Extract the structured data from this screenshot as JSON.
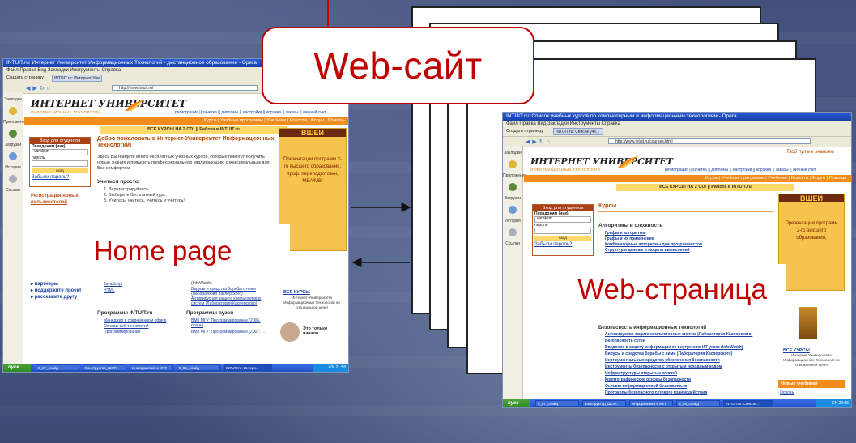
{
  "callout": {
    "title": "Web-сайт"
  },
  "home_label": "Home page",
  "webpage_label": "Web-страница",
  "left_window": {
    "title": "INTUIT.ru: Интернет Университет Информационных Технологий - дистанционное образование - Opera",
    "menu": "Файл  Правка  Вид  Закладки  Инструменты  Справка",
    "tab_new": "Создать страницу",
    "tab_active": "INTUIT.ru: Интернет Уни...",
    "address": "http://www.intuit.ru/",
    "side_items": [
      "Закладки",
      "Приложения",
      "Загрузки",
      "История",
      "Ссылки"
    ],
    "logo": "ИНТЕРНЕТ УНИВЕРСИТЕТ",
    "logo_sub": "ИНФОРМАЦИОННЫХ ТЕХНОЛОГИЙ",
    "top_links": "регистрация || зачетка || дипломы || настройки || корзина || заказы || личный счет",
    "nav": "Курсы | Учебные программы | Учебники | Новости | Форум | Помощь",
    "all_courses": "ВСЕ КУРСЫ НА 2 CD! || Работа в INTUIT.ru",
    "login": {
      "header": "Вход для студентов",
      "alias_label": "Псевдоним (ник)",
      "alias_value": "varaksin",
      "password_label": "пароль",
      "button": "вход",
      "forgot": "Забыли пароль?"
    },
    "reg": "Регистрация новых пользователей",
    "welcome": "Добро пожаловать в Интернет-Университет Информационных Технологий!",
    "intro": "Здесь Вы найдете много бесплатных учебных курсов, которые помогут получить новые знания и повысить профессиональную квалификацию с максимальным для Вас комфортом.",
    "study_title": "Учиться просто:",
    "steps": [
      "1. Зарегистрируйтесь.",
      "2. Выберите бесплатный курс.",
      "3. Учитесь, учитесь, учитесь и учитесь!"
    ],
    "ad_top": "ВШЕИ",
    "ad_text": "Презентации программ 2-го высшего образования, проф. переподготовки, MBA/MBI",
    "bottom_links": [
      "партнеры",
      "поддержите проект",
      "расскажите другу"
    ],
    "mid_links": [
      "JavaScript",
      "HTML"
    ],
    "mid_right": [
      "(InfoWatch)",
      "Вирусы и средства борьбы с ними (Лаборатория Касперского)",
      "Антивирусная защита компьютерных систем (Лаборатория Касперского)"
    ],
    "programs_title": "Программы INTUIT.ru",
    "programs": [
      "Менеджер в современном офисе",
      "Основы веб-технологий",
      "Программирование"
    ],
    "uni_title": "Программы вузов",
    "uni": [
      "ВМК МГУ: Программирование (2006, осень)",
      "ВМК МГУ: Программирование (2007, ..."
    ],
    "promo": "ВСЕ КУРСЫ",
    "promo_text": "Интернет-Университета Информационных Технологий по специальной цене!",
    "only_begin": "Это только начало",
    "taskbar": {
      "start": "пуск",
      "items": [
        "9_67_слайд",
        "Конструктор_ШОР...",
        "Информатика и ИКТ",
        "9_55_слайд",
        "INTUIT.ru: Интерн..."
      ],
      "tray": "EN  21:58"
    }
  },
  "right_window": {
    "title": "INTUIT.ru: Список учебных курсов по компьютерным и информационным технологиям - Opera",
    "menu": "Файл  Правка  Вид  Закладки  Инструменты  Справка",
    "tab_new": "Создать страницу",
    "tab_active": "INTUIT.ru: Список уче...",
    "address": "http://www.intuit.ru/courses.html",
    "slogan": "Твой путь к знаниям",
    "side_items": [
      "Закладки",
      "Приложения",
      "Загрузки",
      "История",
      "Ссылки"
    ],
    "logo": "ИНТЕРНЕТ УНИВЕРСИТЕТ",
    "logo_sub": "ИНФОРМАЦИОННЫХ ТЕХНОЛОГИЙ",
    "top_links": "регистрация || зачетка || дипломы || настройки || корзина || заказы || личный счет",
    "nav": "Курсы | Учебные программы | Учебники | Новости | Форум | Помощь",
    "all_courses": "ВСЕ КУРСЫ НА 2 CD! || Работа в INTUIT.ru",
    "login": {
      "header": "Вход для студентов",
      "alias_label": "Псевдоним (ник)",
      "alias_value": "varaksin",
      "password_label": "пароль",
      "button": "вход",
      "forgot": "Забыли пароль?"
    },
    "courses_title": "Курсы",
    "algo_title": "Алгоритмы и сложность",
    "algo": [
      "Графы и алгоритмы",
      "Графы и их применение",
      "Комбинаторные алгоритмы для программистов",
      "Структуры данных и модели вычислений"
    ],
    "sec_title": "Безопасность информационных технологий",
    "sec": [
      "Антивирусная защита компьютерных систем (Лаборатория Касперского)",
      "Безопасность сетей",
      "Введение в защиту информации от внутренних ИТ-угроз (InfoWatch)",
      "Вирусы и средства борьбы с ними (Лаборатория Касперского)",
      "Инструментальные средства обеспечения безопасности",
      "Инструменты безопасности с открытым исходным кодом",
      "Инфраструктуры открытых ключей",
      "Криптографические основы безопасности",
      "Основы информационной безопасности",
      "Протоколы безопасного сетевого взаимодействия"
    ],
    "ad_top": "ВШЕИ",
    "ad_text": "Презентации программ 2-го высшего образования,",
    "promo": "ВСЕ КУРСЫ",
    "promo_text": "Интернет Университета Информационных Технологий по специальной цене!",
    "new_books": "Новые учебники",
    "basics": "Основы",
    "taskbar": {
      "start": "пуск",
      "items": [
        "9_67_слайд",
        "Конструктор_ШОР...",
        "Информатика и ИКТ",
        "9_55_слайд",
        "INTUIT.ru: Список ..."
      ],
      "tray": "EN  22:05"
    }
  }
}
